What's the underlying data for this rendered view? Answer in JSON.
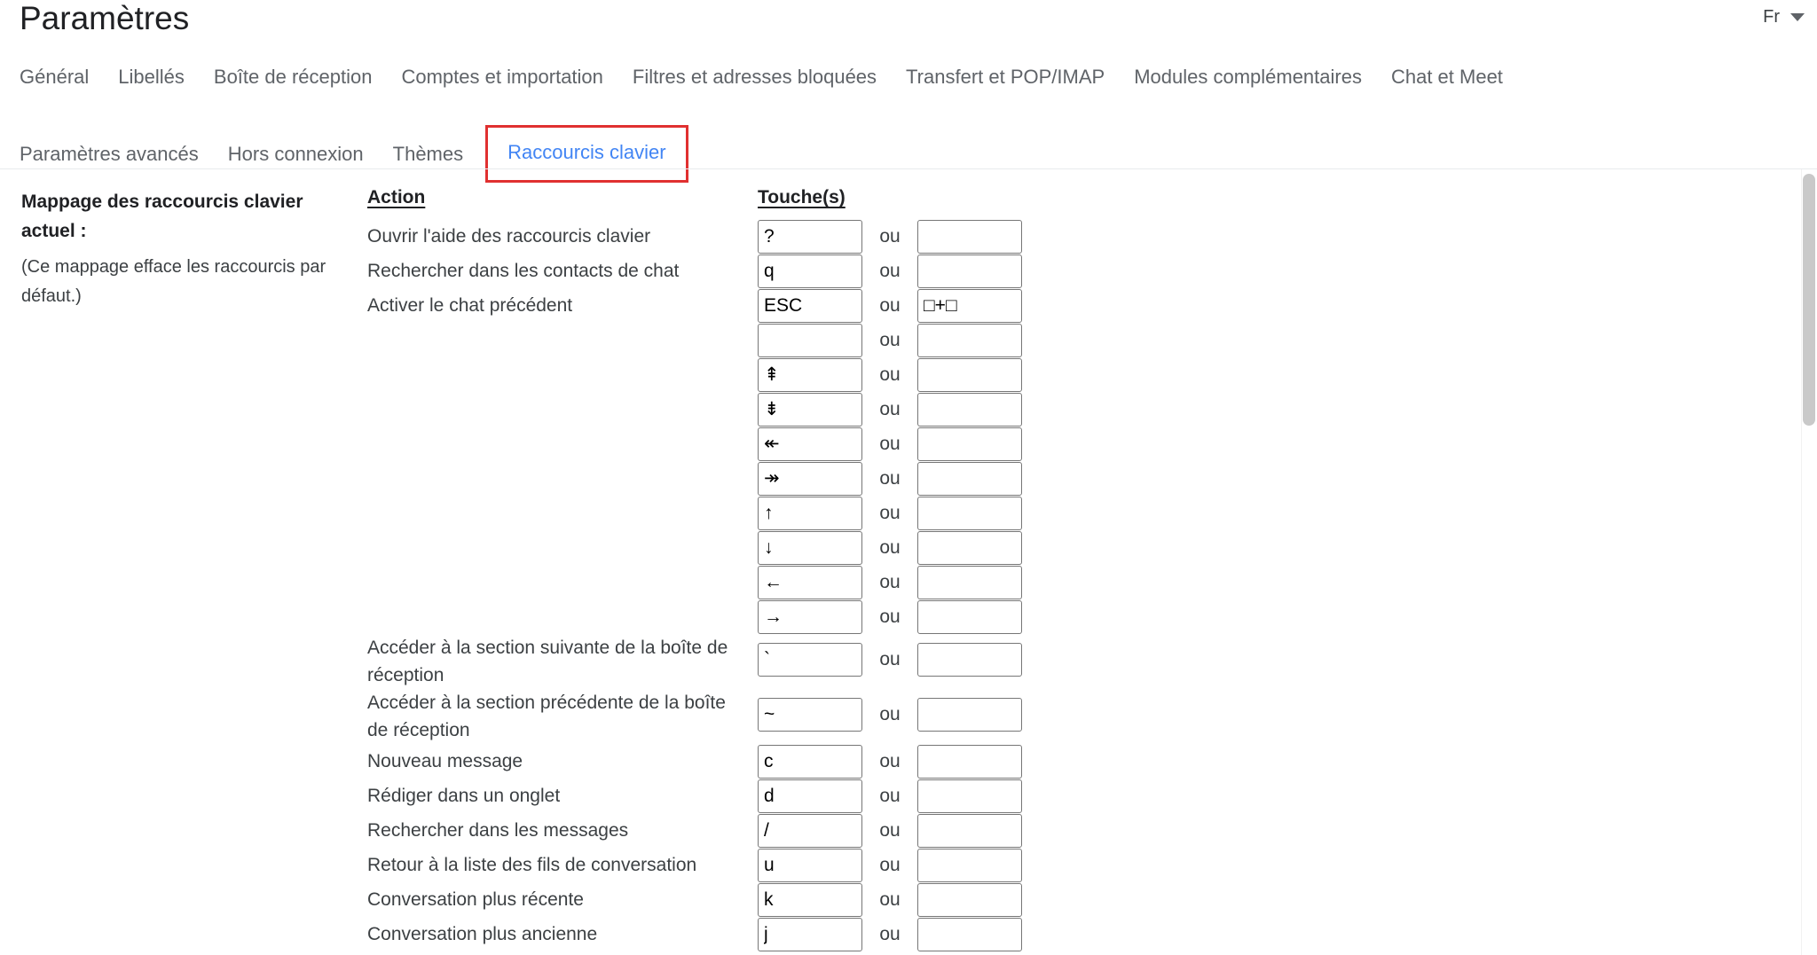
{
  "header": {
    "title": "Paramètres",
    "language_chip": "Fr",
    "language_caret_icon": "chevron-down-icon"
  },
  "tabs": {
    "row1": [
      {
        "label": "Général",
        "active": false
      },
      {
        "label": "Libellés",
        "active": false
      },
      {
        "label": "Boîte de réception",
        "active": false
      },
      {
        "label": "Comptes et importation",
        "active": false
      },
      {
        "label": "Filtres et adresses bloquées",
        "active": false
      },
      {
        "label": "Transfert et POP/IMAP",
        "active": false
      },
      {
        "label": "Modules complémentaires",
        "active": false
      },
      {
        "label": "Chat et Meet",
        "active": false
      }
    ],
    "row2": [
      {
        "label": "Paramètres avancés",
        "active": false
      },
      {
        "label": "Hors connexion",
        "active": false
      },
      {
        "label": "Thèmes",
        "active": false
      },
      {
        "label": "Raccourcis clavier",
        "active": true,
        "highlighted": true
      }
    ]
  },
  "sidebar": {
    "title": "Mappage des raccourcis clavier actuel :",
    "note": "(Ce mappage efface les raccourcis par défaut.)"
  },
  "table": {
    "header_action": "Action",
    "header_keys": "Touche(s)",
    "or_label": "ou",
    "rows": [
      {
        "action": "Ouvrir l'aide des raccourcis clavier",
        "key1": "?",
        "key2": ""
      },
      {
        "action": "Rechercher dans les contacts de chat",
        "key1": "q",
        "key2": ""
      },
      {
        "action": "Activer le chat précédent",
        "key1": "ESC",
        "key2": "□+□"
      },
      {
        "action": "",
        "key1": "",
        "key2": ""
      },
      {
        "action": "",
        "key1": "⇞",
        "key2": ""
      },
      {
        "action": "",
        "key1": "⇟",
        "key2": ""
      },
      {
        "action": "",
        "key1": "↞",
        "key2": ""
      },
      {
        "action": "",
        "key1": "↠",
        "key2": ""
      },
      {
        "action": "",
        "key1": "↑",
        "key2": ""
      },
      {
        "action": "",
        "key1": "↓",
        "key2": ""
      },
      {
        "action": "",
        "key1": "←",
        "key2": ""
      },
      {
        "action": "",
        "key1": "→",
        "key2": ""
      },
      {
        "action": "Accéder à la section suivante de la boîte de réception",
        "key1": "`",
        "key2": "",
        "tall": true
      },
      {
        "action": "Accéder à la section précédente de la boîte de réception",
        "key1": "~",
        "key2": "",
        "tall": true
      },
      {
        "action": "Nouveau message",
        "key1": "c",
        "key2": ""
      },
      {
        "action": "Rédiger dans un onglet",
        "key1": "d",
        "key2": ""
      },
      {
        "action": "Rechercher dans les messages",
        "key1": "/",
        "key2": ""
      },
      {
        "action": "Retour à la liste des fils de conversation",
        "key1": "u",
        "key2": ""
      },
      {
        "action": "Conversation plus récente",
        "key1": "k",
        "key2": ""
      },
      {
        "action": "Conversation plus ancienne",
        "key1": "j",
        "key2": ""
      }
    ]
  },
  "scrollbar": {
    "name": "vertical-scrollbar"
  },
  "colors": {
    "accent_blue": "#4285f4",
    "highlight_red": "#e03030",
    "text_primary": "#202124",
    "text_secondary": "#3c4043",
    "tab_grey": "#5f6368"
  }
}
